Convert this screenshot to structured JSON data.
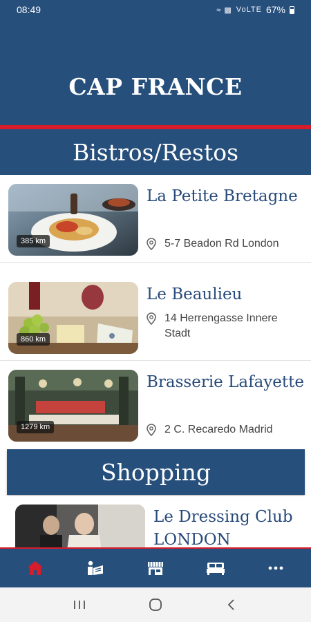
{
  "status_bar": {
    "time": "08:49",
    "network": "VoLTE",
    "battery": "67%"
  },
  "app": {
    "title": "CAP FRANCE"
  },
  "sections": [
    {
      "title": "Bistros/Restos",
      "items": [
        {
          "name": "La Petite Bretagne",
          "address": "5-7 Beadon Rd London",
          "distance": "385 km"
        },
        {
          "name": "Le Beaulieu",
          "address": "14 Herrengasse Innere Stadt",
          "distance": "860 km"
        },
        {
          "name": "Brasserie Lafayette",
          "address": "2 C. Recaredo Madrid",
          "distance": "1279 km"
        }
      ]
    },
    {
      "title": "Shopping",
      "items": [
        {
          "name": "Le Dressing Club LONDON"
        }
      ]
    }
  ],
  "bottom_nav": [
    {
      "icon": "home-icon",
      "active": true
    },
    {
      "icon": "guide-icon"
    },
    {
      "icon": "store-icon"
    },
    {
      "icon": "bed-icon"
    },
    {
      "icon": "more-icon"
    }
  ],
  "colors": {
    "primary": "#264f7c",
    "accent_red": "#d71c2b",
    "title_text": "#274a7a",
    "address_text": "#444444"
  }
}
